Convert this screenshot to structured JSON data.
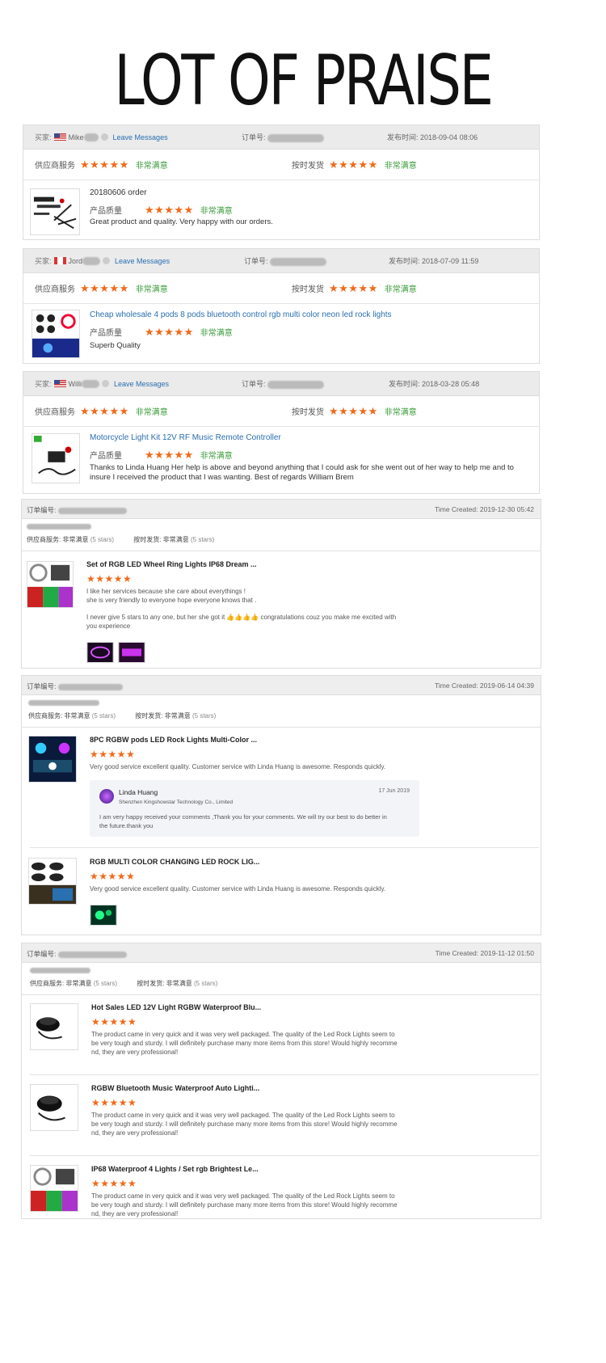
{
  "title": "LOT OF PRAISE",
  "colors": {
    "star": "#f06a1a",
    "satisfied": "#3a9b3a",
    "link": "#2a6fb0"
  },
  "cards": [
    {
      "buyer_label": "买家:",
      "buyer_name": "Mike",
      "leave": "Leave Messages",
      "order_label": "订单号:",
      "date_label": "发布时间:",
      "date": "2018-09-04 08:06",
      "supplier_label": "供应商服务",
      "stars": "★★★★★",
      "sat": "非常满意",
      "ship_label": "按时发货",
      "product": "20180606 order",
      "quality_label": "产品质量",
      "review": "Great product and quality. Very happy with our orders."
    },
    {
      "buyer_label": "买家:",
      "buyer_name": "Jord",
      "leave": "Leave Messages",
      "order_label": "订单号:",
      "date_label": "发布时间:",
      "date": "2018-07-09 11:59",
      "supplier_label": "供应商服务",
      "stars": "★★★★★",
      "sat": "非常满意",
      "ship_label": "按时发货",
      "product": "Cheap wholesale 4 pods 8 pods bluetooth control rgb multi color neon led rock lights",
      "quality_label": "产品质量",
      "review": "Superb Quality"
    },
    {
      "buyer_label": "买家:",
      "buyer_name": "Willi",
      "leave": "Leave Messages",
      "order_label": "订单号:",
      "date_label": "发布时间:",
      "date": "2018-03-28 05:48",
      "supplier_label": "供应商服务",
      "stars": "★★★★★",
      "sat": "非常满意",
      "ship_label": "按时发货",
      "product": "Motorcycle Light Kit 12V RF Music Remote Controller",
      "quality_label": "产品质量",
      "review1": "Thanks to Linda Huang Her help is above and beyond anything that I could ask for she went out of her way to help me and to",
      "review2": "insure I received the product that I was wanting. Best of regards William Brem"
    }
  ],
  "orders": [
    {
      "order_label": "订单编号:",
      "time": "Time Created: 2019-12-30 05:42",
      "svc": "供应商服务:",
      "svc_val": "非常满意",
      "svc_stars": "(5 stars)",
      "ship": "按时发货:",
      "ship_val": "非常满意",
      "ship_stars": "(5 stars)",
      "items": [
        {
          "name": "Set of RGB LED Wheel Ring Lights IP68 Dream ...",
          "stars": "★★★★★",
          "l1": "I like her services because she care about everythings !",
          "l2": "she is very friendly to everyone hope everyone knows that .",
          "l3": "I never give 5 stars to any one, but her she  got it 👍👍👍👍 congratulations  couz you make me excited with",
          "l4": "you experience"
        }
      ]
    },
    {
      "order_label": "订单编号:",
      "time": "Time Created: 2019-06-14 04:39",
      "svc": "供应商服务:",
      "svc_val": "非常满意",
      "svc_stars": "(5 stars)",
      "ship": "按时发货:",
      "ship_val": "非常满意",
      "ship_stars": "(5 stars)",
      "items": [
        {
          "name": "8PC RGBW pods LED Rock Lights Multi-Color ...",
          "stars": "★★★★★",
          "l1": "Very good service excellent quality. Customer service with Linda Huang is awesome.  Responds quickly."
        },
        {
          "name": "RGB MULTI COLOR CHANGING LED ROCK LIG...",
          "stars": "★★★★★",
          "l1": "Very good service excellent quality. Customer service with Linda Huang is awesome.  Responds quickly."
        }
      ],
      "reply": {
        "name": "Linda Huang",
        "company": "Shenzhen Kingshowstar Technology Co., Limited",
        "date": "17 Jun 2019",
        "t1": "I am very happy received your comments ,Thank you for your comments. We will try our best to do better in",
        "t2": "the future.thank you"
      }
    },
    {
      "order_label": "订单编号:",
      "time": "Time Created: 2019-11-12 01:50",
      "svc": "供应商服务:",
      "svc_val": "非常满意",
      "svc_stars": "(5 stars)",
      "ship": "按时发货:",
      "ship_val": "非常满意",
      "ship_stars": "(5 stars)",
      "items": [
        {
          "name": "Hot Sales LED 12V Light RGBW Waterproof Blu...",
          "stars": "★★★★★"
        },
        {
          "name": "RGBW Bluetooth Music Waterproof Auto Lighti...",
          "stars": "★★★★★"
        },
        {
          "name": "IP68 Waterproof 4 Lights / Set rgb Brightest Le...",
          "stars": "★★★★★"
        }
      ],
      "l1": "The product came in very quick and it was very well packaged. The quality of the Led Rock Lights seem to",
      "l2": "be very tough and sturdy. I will definitely purchase many more items from this store! Would highly recomme",
      "l3": "nd, they are very professional!"
    }
  ]
}
